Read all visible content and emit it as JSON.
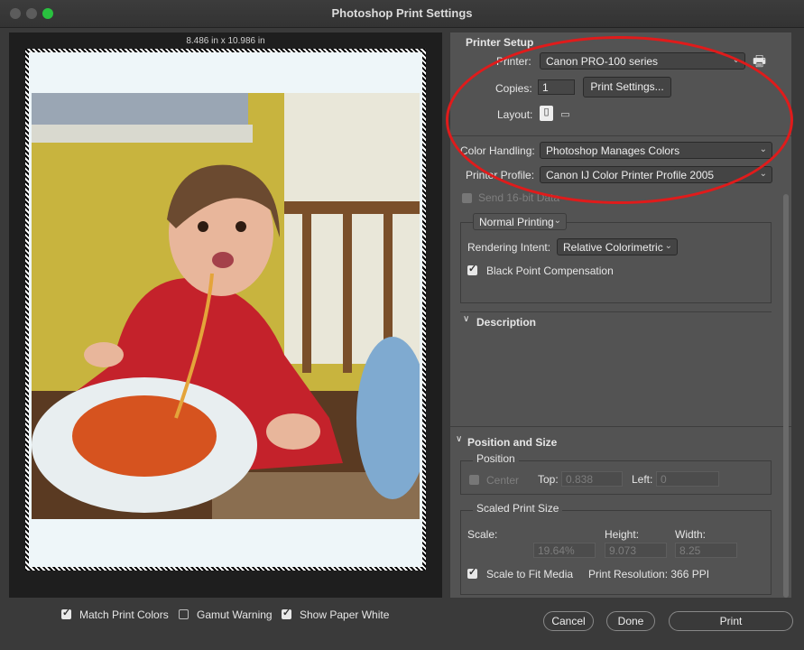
{
  "window": {
    "title": "Photoshop Print Settings"
  },
  "preview": {
    "dimensions": "8.486 in x 10.986 in"
  },
  "printer_setup": {
    "heading": "Printer Setup",
    "printer_label": "Printer:",
    "printer_value": "Canon PRO-100 series",
    "copies_label": "Copies:",
    "copies_value": "1",
    "print_settings_button": "Print Settings...",
    "layout_label": "Layout:"
  },
  "color": {
    "handling_label": "Color Handling:",
    "handling_value": "Photoshop Manages Colors",
    "profile_label": "Printer Profile:",
    "profile_value": "Canon IJ Color Printer Profile 2005",
    "send16_label": "Send 16-bit Data",
    "mode_value": "Normal Printing",
    "rendering_label": "Rendering Intent:",
    "rendering_value": "Relative Colorimetric",
    "bpc_label": "Black Point Compensation"
  },
  "description": {
    "heading": "Description"
  },
  "position_size": {
    "heading": "Position and Size",
    "position_label": "Position",
    "center_label": "Center",
    "top_label": "Top:",
    "top_value": "0.838",
    "left_label": "Left:",
    "left_value": "0",
    "scaled_label": "Scaled Print Size",
    "scale_label": "Scale:",
    "height_label": "Height:",
    "width_label": "Width:",
    "scale_value": "19.64%",
    "height_value": "9.073",
    "width_value": "8.25",
    "fit_label": "Scale to Fit Media",
    "resolution": "Print Resolution: 366 PPI"
  },
  "bottom": {
    "match_colors": "Match Print Colors",
    "gamut_warning": "Gamut Warning",
    "show_paper_white": "Show Paper White",
    "cancel": "Cancel",
    "done": "Done",
    "print": "Print"
  },
  "colors": {
    "annotation": "#e01b1b",
    "panel": "#535353",
    "accent_green": "#29c13f"
  }
}
